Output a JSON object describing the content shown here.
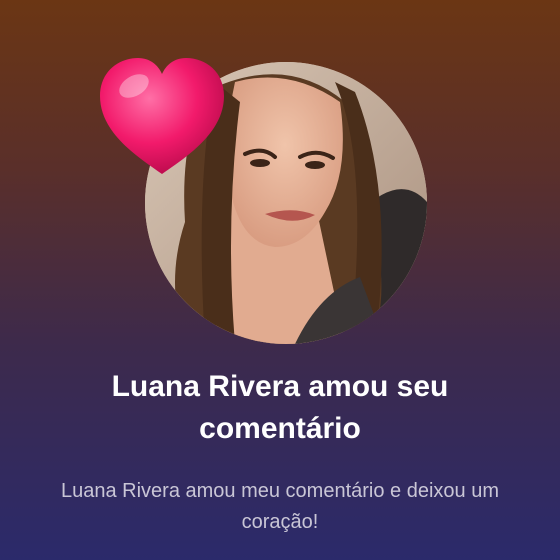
{
  "notification": {
    "title": "Luana Rivera amou seu comentário",
    "message": "Luana Rivera amou meu comentário e deixou um coração!"
  },
  "icons": {
    "heart": "heart-icon",
    "avatar": "profile-photo"
  },
  "colors": {
    "background_top": "#6b3614",
    "background_bottom": "#2b2a6b",
    "heart": "#f21a6b",
    "title_text": "#ffffff",
    "message_text": "#c9c6d6"
  }
}
